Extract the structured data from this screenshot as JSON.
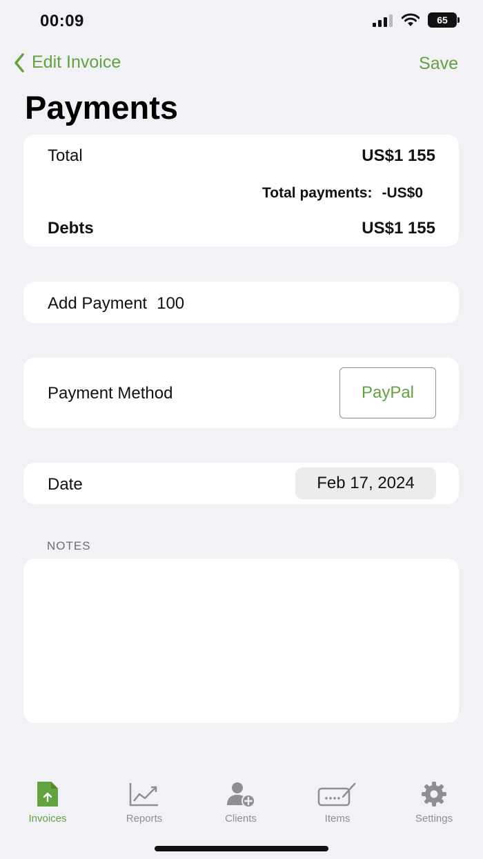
{
  "status_bar": {
    "time": "00:09",
    "battery": "65"
  },
  "nav": {
    "back_label": "Edit Invoice",
    "save_label": "Save"
  },
  "title": "Payments",
  "summary": {
    "total_label": "Total",
    "total_value": "US$1 155",
    "payments_label": "Total payments:",
    "payments_value": "-US$0",
    "debts_label": "Debts",
    "debts_value": "US$1 155"
  },
  "add_payment": {
    "label": "Add Payment",
    "value": "100"
  },
  "payment_method": {
    "label": "Payment Method",
    "value": "PayPal"
  },
  "date": {
    "label": "Date",
    "value": "Feb 17, 2024"
  },
  "notes": {
    "header": "NOTES",
    "value": ""
  },
  "tabs": [
    {
      "label": "Invoices",
      "icon": "invoice-icon",
      "active": true
    },
    {
      "label": "Reports",
      "icon": "chart-icon",
      "active": false
    },
    {
      "label": "Clients",
      "icon": "add-person-icon",
      "active": false
    },
    {
      "label": "Items",
      "icon": "tag-icon",
      "active": false
    },
    {
      "label": "Settings",
      "icon": "gear-icon",
      "active": false
    }
  ],
  "colors": {
    "accent": "#62a33f",
    "background": "#f2f1f6",
    "inactive_tab": "#8e8e93"
  }
}
